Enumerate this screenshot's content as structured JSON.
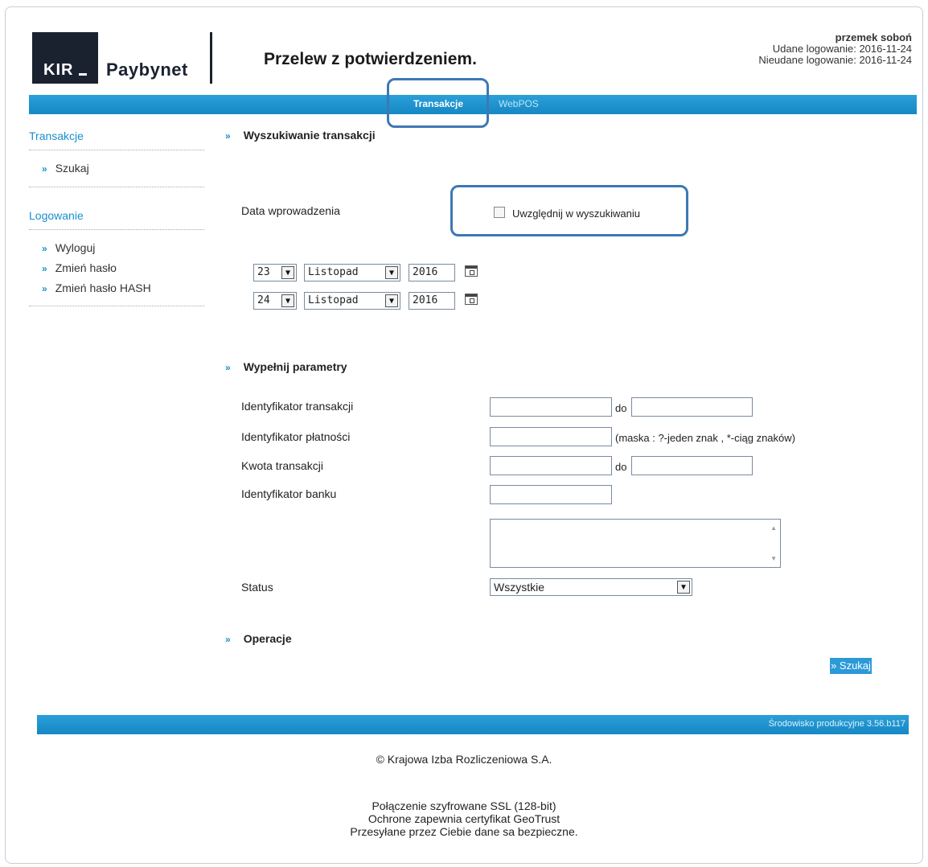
{
  "header": {
    "logo_mark": "KIR",
    "logo_name": "Paybynet",
    "title": "Przelew z potwierdzeniem.",
    "user_name": "przemek soboń",
    "login_ok": "Udane logowanie: 2016-11-24",
    "login_fail": "Nieudane logowanie: 2016-11-24"
  },
  "nav": {
    "tabs": [
      {
        "label": "Transakcje",
        "active": true
      },
      {
        "label": "WebPOS",
        "active": false
      }
    ]
  },
  "sidebar": {
    "sections": [
      {
        "title": "Transakcje",
        "items": [
          "Szukaj"
        ]
      },
      {
        "title": "Logowanie",
        "items": [
          "Wyloguj",
          "Zmień hasło",
          "Zmień hasło HASH"
        ]
      }
    ],
    "bullet": "»"
  },
  "main": {
    "search_section": "Wyszukiwanie transakcji",
    "date_label": "Data wprowadzenia",
    "include_label": "Uwzględnij w wyszukiwaniu",
    "date_from": {
      "day": "23",
      "month": "Listopad",
      "year": "2016"
    },
    "date_to": {
      "day": "24",
      "month": "Listopad",
      "year": "2016"
    },
    "params_section": "Wypełnij parametry",
    "fields": {
      "transaction_id": "Identyfikator transakcji",
      "payment_id": "Identyfikator płatności",
      "amount": "Kwota transakcji",
      "bank_id": "Identyfikator banku",
      "status": "Status"
    },
    "to_label": "do",
    "mask_hint": "(maska : ?-jeden znak , *-ciąg znaków)",
    "status_value": "Wszystkie",
    "ops_section": "Operacje",
    "search_button": "» Szukaj"
  },
  "footer": {
    "env": "Środowisko produkcyjne 3.56.b117",
    "copyright": "© Krajowa Izba Rozliczeniowa S.A.",
    "ssl_1": "Połączenie szyfrowane SSL (128-bit)",
    "ssl_2": "Ochrone zapewnia certyfikat GeoTrust",
    "ssl_3": "Przesyłane przez Ciebie dane sa bezpieczne."
  },
  "colors": {
    "accent": "#1a8fcc",
    "bar": "#1688c4",
    "highlight": "#3d78b5"
  }
}
